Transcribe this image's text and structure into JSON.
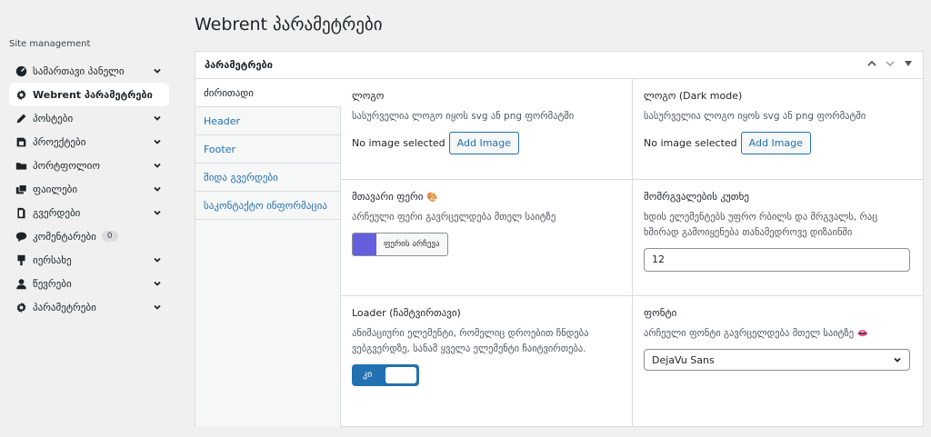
{
  "sidebar": {
    "section_label": "Site management",
    "items": [
      {
        "label": "სამართავი პანელი",
        "icon": "dashboard-icon"
      },
      {
        "label": "Webrent პარამეტრები",
        "icon": "gear-icon"
      },
      {
        "label": "პოსტები",
        "icon": "pen-icon"
      },
      {
        "label": "პროექტები",
        "icon": "project-icon"
      },
      {
        "label": "პორტფოლიო",
        "icon": "folder-icon"
      },
      {
        "label": "ფაილები",
        "icon": "media-icon"
      },
      {
        "label": "გვერდები",
        "icon": "page-icon"
      },
      {
        "label": "კომენტარები",
        "icon": "comment-icon",
        "badge": "0"
      },
      {
        "label": "იერსახე",
        "icon": "brush-icon"
      },
      {
        "label": "წევრები",
        "icon": "user-icon"
      },
      {
        "label": "პარამეტრები",
        "icon": "settings-icon"
      }
    ]
  },
  "page": {
    "title": "Webrent პარამეტრები"
  },
  "panel": {
    "title": "პარამეტრები",
    "tabs": [
      "ძირითადი",
      "Header",
      "Footer",
      "შიდა გვერდები",
      "საკონტაქტო ინფორმაცია"
    ]
  },
  "fields": {
    "logo": {
      "title": "ლოგო",
      "desc": "სასურველია ლოგო იყოს svg ან png ფორმატში",
      "status": "No image selected",
      "button": "Add Image"
    },
    "logo_dark": {
      "title": "ლოგო (Dark mode)",
      "desc": "სასურველია ლოგო იყოს svg ან png ფორმატში",
      "status": "No image selected",
      "button": "Add Image"
    },
    "main_color": {
      "title": "მთავარი ფერი",
      "emoji": "🎨",
      "desc": "არჩეული ფერი გავრცელდება მთელ საიტზე",
      "button": "ფერის არჩევა",
      "color": "#6460dd"
    },
    "radius": {
      "title": "მომრგვალების კუთხე",
      "desc": "ხდის ელემენტებს უფრო რბილს და მრგვალს, რაც ხშირად გამოიყენება თანამედროვე დიზაინში",
      "value": "12"
    },
    "loader": {
      "title": "Loader (ჩამტვირთავი)",
      "desc": "ანიმაციური ელემენტი, რომელიც დროებით ჩნდება ვებგვერდზე, სანამ ყველა ელემენტი ჩაიტვირთება.",
      "toggle_label": "კი"
    },
    "font": {
      "title": "ფონტი",
      "desc": "არჩეული ფონტი გავრცელდება მთელ საიტზე",
      "emoji": "👄",
      "value": "DejaVu Sans"
    }
  },
  "colors": {
    "accent": "#2271b1",
    "swatch": "#6460dd"
  }
}
